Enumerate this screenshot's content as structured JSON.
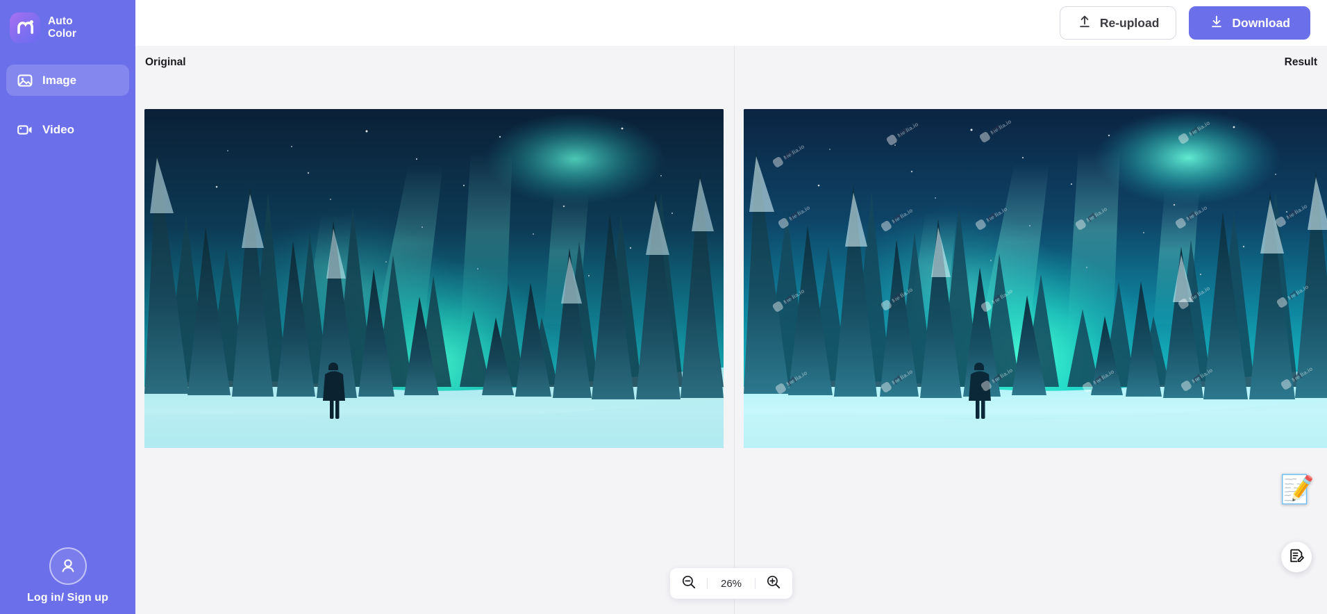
{
  "app": {
    "brand_name": "Auto\nColor",
    "brand_logo_icon": "mediaio-m-logo-icon"
  },
  "sidebar": {
    "items": [
      {
        "label": "Image",
        "icon": "image-icon",
        "active": true
      },
      {
        "label": "Video",
        "icon": "video-camera-icon",
        "active": false
      }
    ],
    "account": {
      "label": "Log in/ Sign up",
      "icon": "user-avatar-icon"
    }
  },
  "toolbar": {
    "reupload_label": "Re-upload",
    "reupload_icon": "upload-icon",
    "download_label": "Download",
    "download_icon": "download-icon"
  },
  "panes": {
    "original_label": "Original",
    "result_label": "Result"
  },
  "image": {
    "subject": "Aurora borealis over snowy spruce forest with a standing person",
    "watermark_text": "Media.io",
    "watermark_icon": "mediaio-m-logo-icon"
  },
  "zoom": {
    "zoom_out_icon": "zoom-out-icon",
    "zoom_in_icon": "zoom-in-icon",
    "level": "26%"
  },
  "floating": {
    "sticker_icon": "memo-sticker-icon",
    "sticker_glyph": "📝",
    "feedback_icon": "feedback-document-pencil-icon"
  },
  "colors": {
    "sidebar": "#6c6fea",
    "accent": "#6c6fea",
    "background": "#f4f4f7",
    "topbar": "#ffffff",
    "text": "#1b1b1f"
  }
}
